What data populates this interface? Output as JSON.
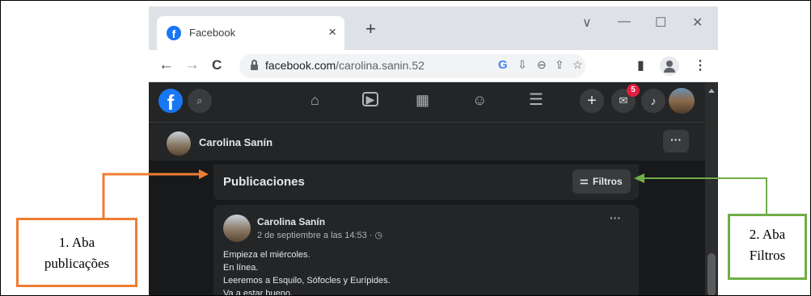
{
  "browser": {
    "tab_title": "Facebook",
    "tab_favicon": "f",
    "new_tab": "+",
    "close_tab": "×",
    "window_controls": {
      "dropdown": "∨",
      "minimize": "—",
      "maximize": "☐",
      "close": "✕"
    },
    "nav": {
      "back": "←",
      "forward": "→",
      "reload": "C"
    },
    "url_host": "facebook.com",
    "url_path": "/carolina.sanin.52",
    "omnibox_icons": {
      "google": "G",
      "install": "⇩",
      "zoom": "⊖",
      "share": "⇪",
      "bookmark": "☆"
    },
    "toolbar_icons": {
      "sidepanel": "▮",
      "menu": "⋮"
    }
  },
  "facebook": {
    "logo": "f",
    "search_icon": "⌕",
    "nav_icons": {
      "home": "⌂",
      "watch": "▶",
      "marketplace": "▦",
      "groups": "☺",
      "menu": "☰"
    },
    "action_icons": {
      "create": "+",
      "messenger": "✉",
      "notifications": "♪"
    },
    "messenger_badge": "5",
    "profile_name": "Carolina Sanín",
    "more_label": "···",
    "publicaciones_title": "Publicaciones",
    "filtros_icon": "⚌",
    "filtros_label": "Filtros",
    "post": {
      "author": "Carolina Sanín",
      "date": "2 de septiembre a las 14:53 · ◷",
      "more": "···",
      "lines": [
        "Empieza el miércoles.",
        "En línea.",
        "Leeremos a Esquilo, Sófocles y Eurípides.",
        "Va a estar bueno."
      ]
    }
  },
  "annotations": {
    "callout1_line1": "1. Aba",
    "callout1_line2": "publicações",
    "callout2_line1": "2. Aba",
    "callout2_line2": "Filtros",
    "colors": {
      "callout1": "#ed7d31",
      "callout2": "#70ad47"
    }
  }
}
